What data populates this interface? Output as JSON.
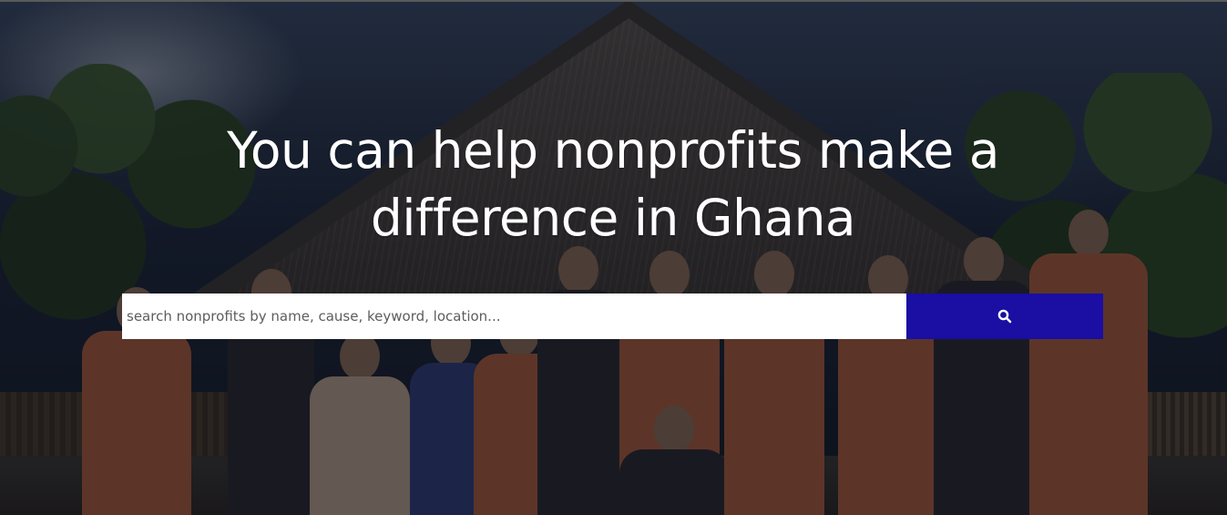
{
  "hero": {
    "headline": "You can help nonprofits make a difference in Ghana"
  },
  "search": {
    "placeholder": "search nonprofits by name, cause, keyword, location...",
    "button_icon": "search-icon",
    "button_color": "#1a0ea3"
  },
  "background": {
    "image_subject": "group of volunteers in orange vests in front of thatched-roof hut",
    "overlay_color": "#080a14"
  }
}
